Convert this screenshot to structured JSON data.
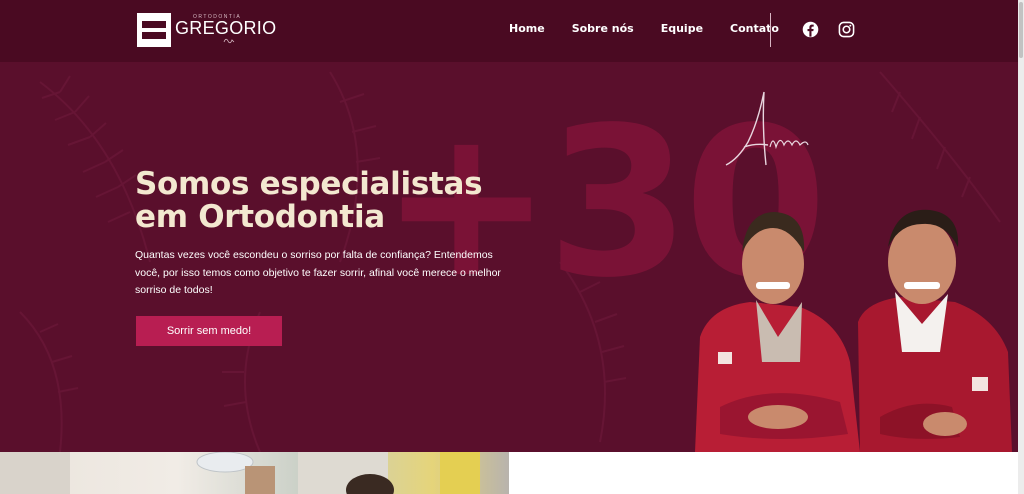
{
  "brand": {
    "name": "GREGORIO",
    "tagline": "ORTODONTIA"
  },
  "nav": {
    "items": [
      {
        "label": "Home"
      },
      {
        "label": "Sobre nós"
      },
      {
        "label": "Equipe"
      },
      {
        "label": "Contato"
      }
    ],
    "social": [
      "facebook-icon",
      "instagram-icon"
    ]
  },
  "hero": {
    "big_number": "+30",
    "anos_script": "Anos",
    "title": "Somos especialistas em Ortodontia",
    "text": "Quantas vezes você escondeu o sorriso por falta de confiança? Entendemos você, por isso temos como objetivo te fazer sorrir, afinal você merece o melhor sorriso de todos!",
    "cta_label": "Sorrir sem medo!"
  },
  "colors": {
    "header_bg": "#4a0a22",
    "hero_bg": "#5a0f2c",
    "accent": "#b81e52",
    "title": "#f3e8d0"
  }
}
